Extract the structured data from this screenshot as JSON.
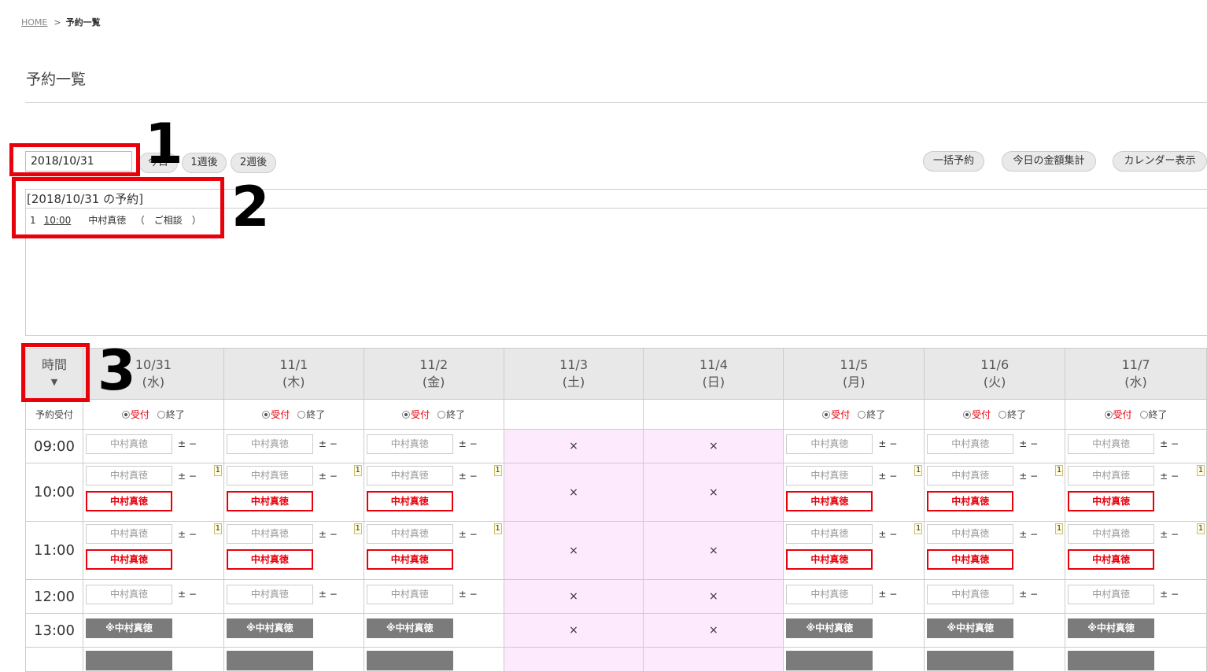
{
  "breadcrumb": {
    "home": "HOME",
    "separator": ">",
    "current": "予約一覧"
  },
  "page_title": "予約一覧",
  "controls": {
    "date_value": "2018/10/31",
    "today_label": "今日",
    "week1_label": "1週後",
    "week2_label": "2週後",
    "bulk_label": "一括予約",
    "total_label": "今日の金額集計",
    "calendar_label": "カレンダー表示"
  },
  "annotations": {
    "n1": "1",
    "n2": "2",
    "n3": "3"
  },
  "reservations": {
    "title": "[2018/10/31 の予約]",
    "rows": [
      {
        "no": "1",
        "time": "10:00",
        "name": "中村真徳",
        "detail": "（　ご相談　）"
      }
    ]
  },
  "schedule": {
    "time_header": "時間",
    "sort_icon": "▼",
    "accept_label": "予約受付",
    "accept_on": "受付",
    "accept_off": "終了",
    "closed_mark": "×",
    "name_placeholder": "中村真徳",
    "plusminus": "± −",
    "badge": "1",
    "booked_name": "中村真徳",
    "gray_name": "※中村真徳",
    "days": [
      {
        "date": "10/31",
        "dow": "(水)",
        "closed": false
      },
      {
        "date": "11/1",
        "dow": "(木)",
        "closed": false
      },
      {
        "date": "11/2",
        "dow": "(金)",
        "closed": false
      },
      {
        "date": "11/3",
        "dow": "(土)",
        "closed": true
      },
      {
        "date": "11/4",
        "dow": "(日)",
        "closed": true
      },
      {
        "date": "11/5",
        "dow": "(月)",
        "closed": false
      },
      {
        "date": "11/6",
        "dow": "(火)",
        "closed": false
      },
      {
        "date": "11/7",
        "dow": "(水)",
        "closed": false
      }
    ],
    "times": [
      "09:00",
      "10:00",
      "11:00",
      "12:00",
      "13:00"
    ],
    "slot_types": [
      "input",
      "booked",
      "booked",
      "input",
      "gray"
    ]
  }
}
